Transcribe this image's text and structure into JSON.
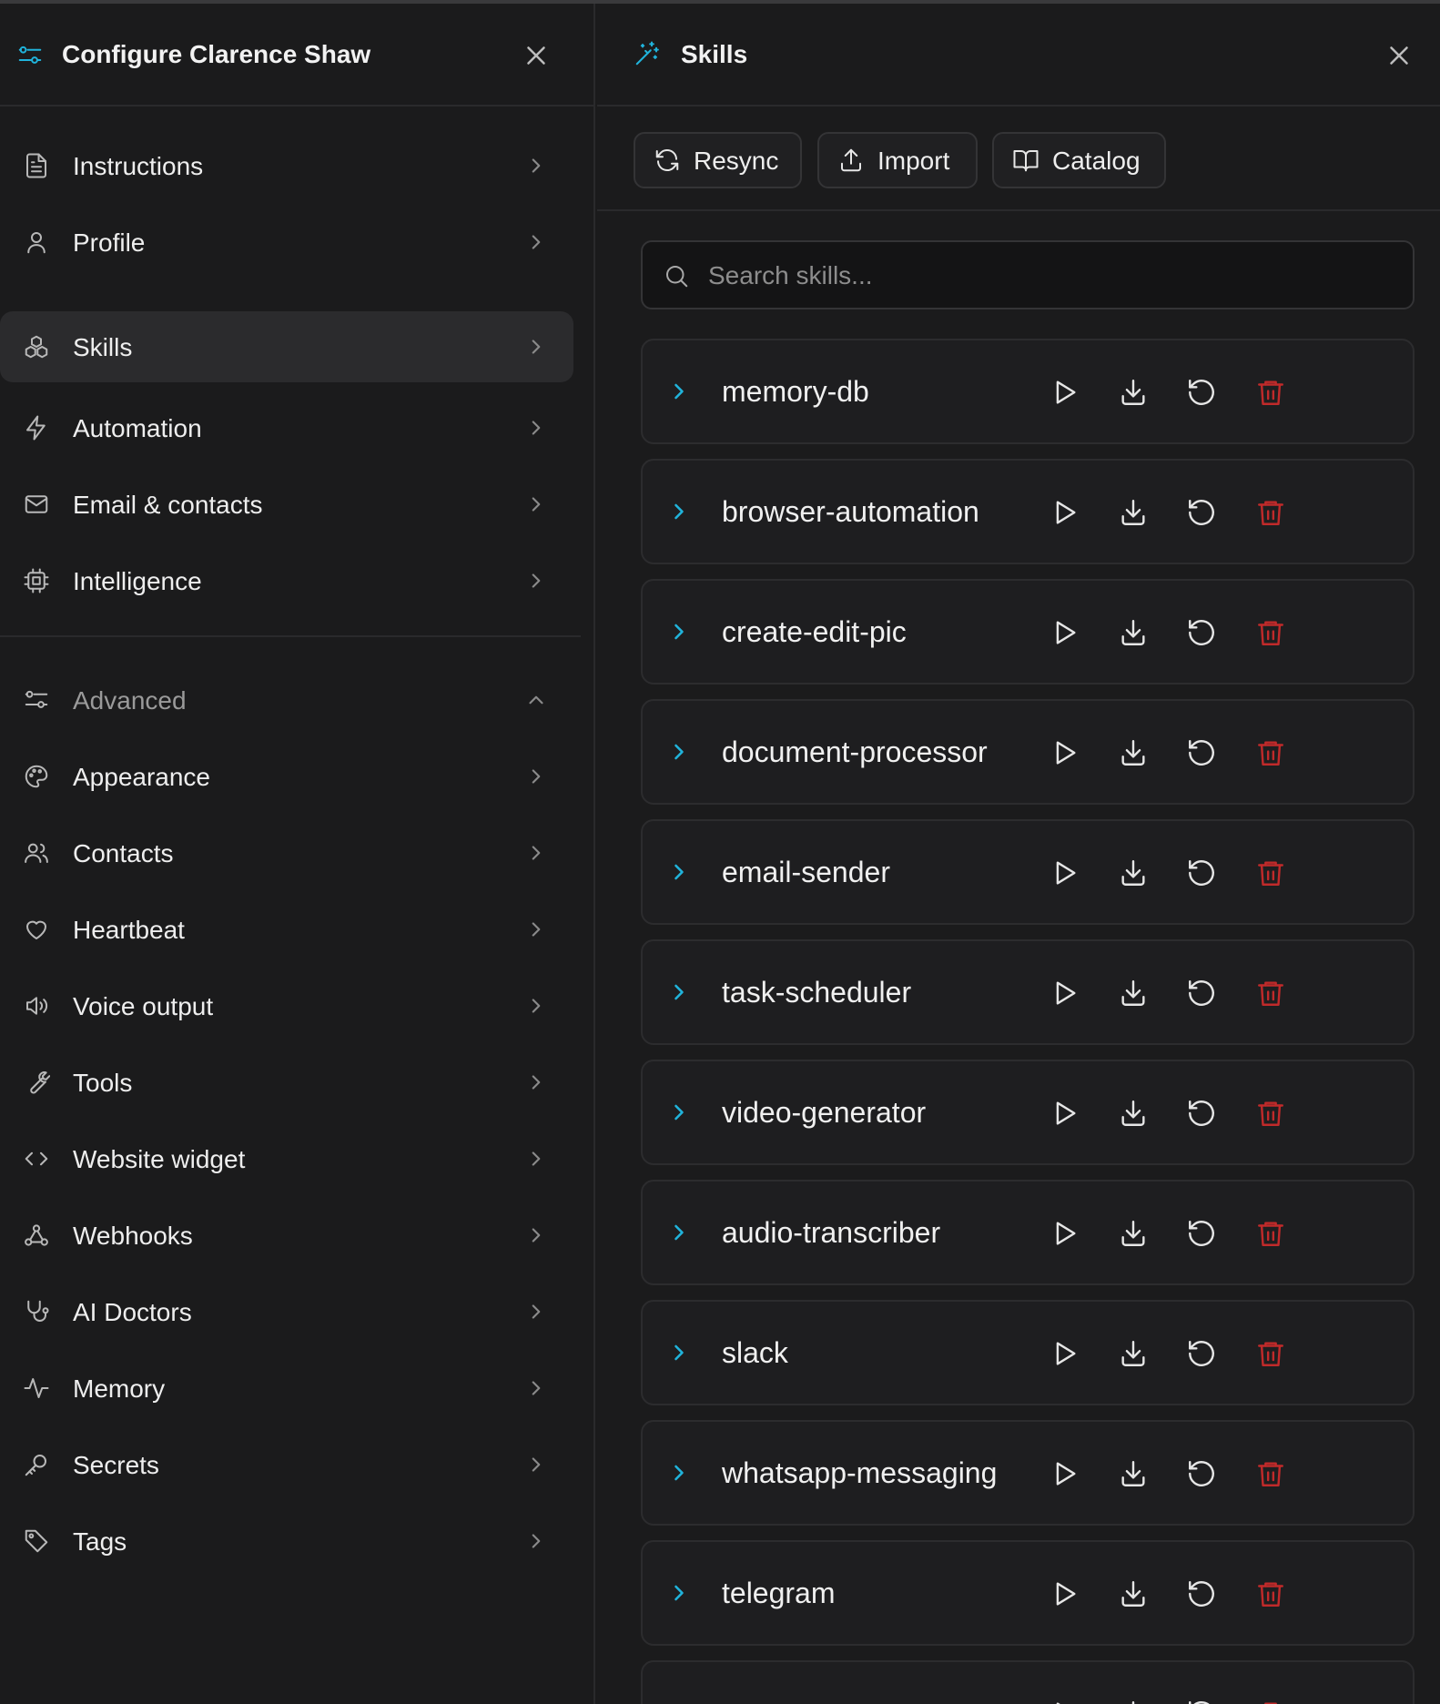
{
  "left_panel": {
    "title": "Configure Clarence Shaw",
    "nav_items": [
      {
        "label": "Instructions",
        "icon": "file-text-icon"
      },
      {
        "label": "Profile",
        "icon": "user-icon"
      },
      {
        "label": "Skills",
        "icon": "boxes-icon",
        "active": true
      },
      {
        "label": "Automation",
        "icon": "zap-icon"
      },
      {
        "label": "Email & contacts",
        "icon": "mail-icon"
      },
      {
        "label": "Intelligence",
        "icon": "cpu-icon"
      }
    ],
    "advanced": {
      "label": "Advanced",
      "expanded": true,
      "items": [
        {
          "label": "Appearance",
          "icon": "palette-icon"
        },
        {
          "label": "Contacts",
          "icon": "users-icon"
        },
        {
          "label": "Heartbeat",
          "icon": "heart-icon"
        },
        {
          "label": "Voice output",
          "icon": "speaker-icon"
        },
        {
          "label": "Tools",
          "icon": "wrench-icon"
        },
        {
          "label": "Website widget",
          "icon": "code-icon"
        },
        {
          "label": "Webhooks",
          "icon": "webhook-icon"
        },
        {
          "label": "AI Doctors",
          "icon": "stethoscope-icon"
        },
        {
          "label": "Memory",
          "icon": "activity-icon"
        },
        {
          "label": "Secrets",
          "icon": "key-icon"
        },
        {
          "label": "Tags",
          "icon": "tag-icon"
        }
      ]
    }
  },
  "right_panel": {
    "title": "Skills",
    "toolbar": {
      "resync_label": "Resync",
      "import_label": "Import",
      "catalog_label": "Catalog"
    },
    "search": {
      "placeholder": "Search skills...",
      "value": ""
    },
    "skills": [
      "memory-db",
      "browser-automation",
      "create-edit-pic",
      "document-processor",
      "email-sender",
      "task-scheduler",
      "video-generator",
      "audio-transcriber",
      "slack",
      "whatsapp-messaging",
      "telegram",
      ""
    ]
  },
  "colors": {
    "background": "#1b1b1c",
    "accent": "#20b4dc",
    "danger": "#c02a2a",
    "active_item": "#2b2b2d"
  }
}
